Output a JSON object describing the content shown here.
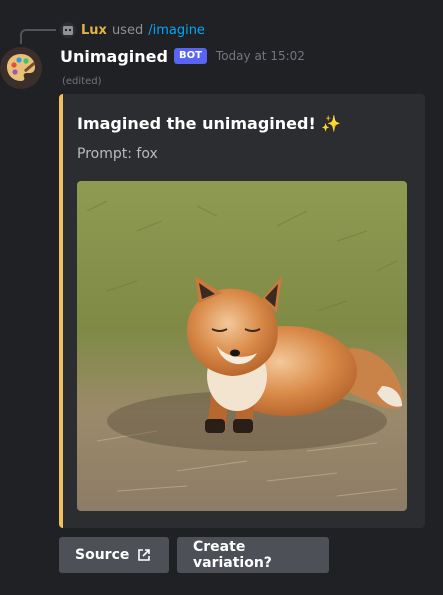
{
  "reply": {
    "user": "Lux",
    "used_text": "used",
    "command": "/imagine"
  },
  "message": {
    "author": "Unimagined",
    "badge": "BOT",
    "timestamp": "Today at 15:02",
    "edited": "(edited)"
  },
  "embed": {
    "title": "Imagined the unimagined! ✨",
    "description": "Prompt: fox",
    "accent_color": "#f0c060",
    "image_subject": "fox lying on grass"
  },
  "buttons": {
    "source_label": "Source",
    "source_icon": "external-link-icon",
    "variation_label": "Create variation?"
  }
}
